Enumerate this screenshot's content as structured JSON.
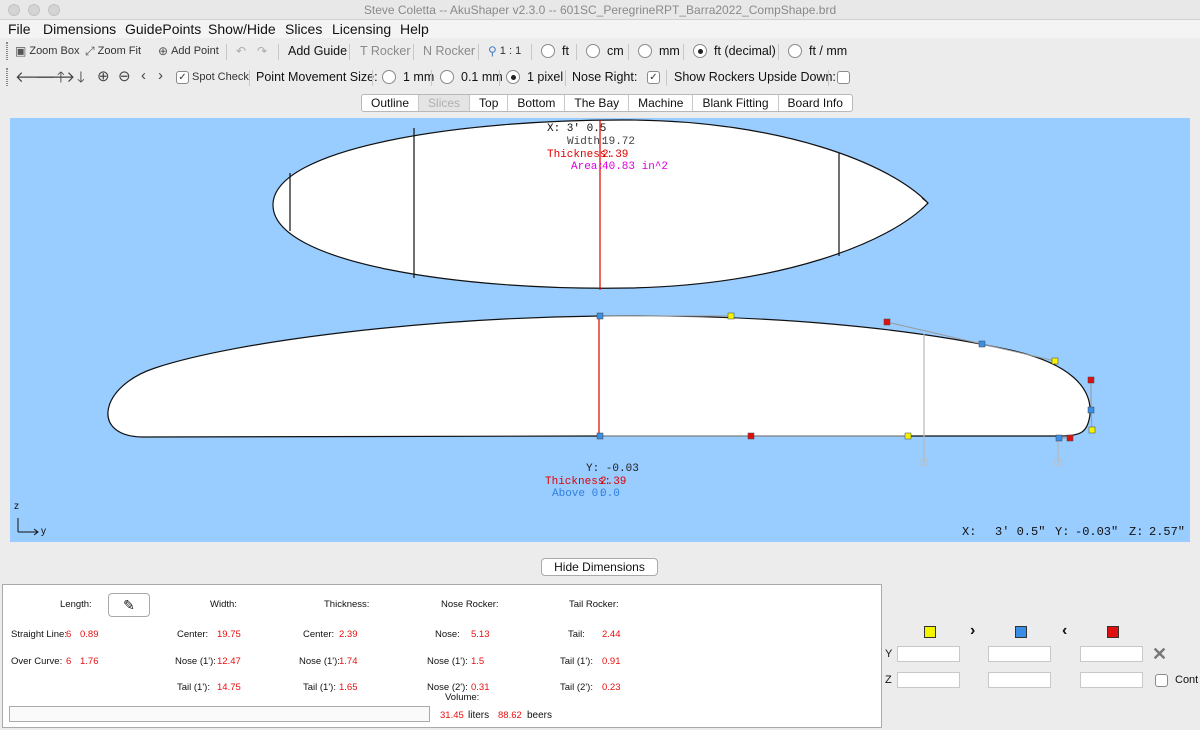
{
  "window": {
    "title": "Steve Coletta -- AkuShaper v2.3.0  --  601SC_PeregrineRPT_Barra2022_CompShape.brd"
  },
  "menu": [
    "File",
    "Dimensions",
    "GuidePoints",
    "Show/Hide",
    "Slices",
    "Licensing",
    "Help"
  ],
  "toolbar1": {
    "zoom_box": "Zoom Box",
    "zoom_fit": "Zoom Fit",
    "add_point": "Add Point",
    "add_guide": "Add Guide",
    "t_rocker": "T Rocker",
    "n_rocker": "N Rocker",
    "scale": "1 : 1",
    "units": [
      {
        "label": "ft",
        "selected": false
      },
      {
        "label": "cm",
        "selected": false
      },
      {
        "label": "mm",
        "selected": false
      },
      {
        "label": "ft (decimal)",
        "selected": true
      },
      {
        "label": "ft / mm",
        "selected": false
      }
    ]
  },
  "toolbar2": {
    "spot_check": "Spot Check",
    "point_movement_label": "Point Movement Size:",
    "movement_options": [
      {
        "label": "1 mm",
        "selected": false
      },
      {
        "label": "0.1 mm",
        "selected": false
      },
      {
        "label": "1 pixel",
        "selected": true
      }
    ],
    "nose_right_label": "Nose Right:",
    "nose_right_checked": true,
    "show_rockers_label": "Show Rockers Upside Down:",
    "show_rockers_checked": false
  },
  "tabs": [
    "Outline",
    "Slices",
    "Top",
    "Bottom",
    "The Bay",
    "Machine",
    "Blank Fitting",
    "Board Info"
  ],
  "active_tab": "Slices",
  "canvas": {
    "outline_info": {
      "x": "X: 3' 0.5",
      "width_label": "Width:",
      "width_value": "19.72",
      "thickness_label": "Thickness:",
      "thickness_value": "2.39",
      "area_label": "Area:",
      "area_value": "40.83 in^2"
    },
    "rocker_info": {
      "y": "Y: -0.03",
      "thickness_label": "Thickness:",
      "thickness_value": "2.39",
      "above_label": "Above 0:",
      "above_value": "0.0"
    },
    "axis_z": "z",
    "axis_y": "y",
    "coords": {
      "x_label": "X:",
      "x_value": "3' 0.5\"",
      "y_label": "Y:",
      "y_value": "-0.03\"",
      "z_label": "Z:",
      "z_value": "2.57\""
    },
    "colors": {
      "background": "#99ccff",
      "cursor_line": "#e00000",
      "control_blue": "#3a8ee6",
      "control_yellow": "#f4f400",
      "control_red": "#e01010",
      "thickness_text": "#e00000",
      "area_text": "#e000e0",
      "above_text": "#2f7fe0"
    }
  },
  "hide_dimensions": "Hide Dimensions",
  "dimensions": {
    "length_label": "Length:",
    "straight_line_label": "Straight Line:",
    "straight_line_ft": "6",
    "straight_line_in": "0.89",
    "over_curve_label": "Over Curve:",
    "over_curve_ft": "6",
    "over_curve_in": "1.76",
    "width_label": "Width:",
    "width_center_label": "Center:",
    "width_center": "19.75",
    "width_nose_label": "Nose (1'):",
    "width_nose": "12.47",
    "width_tail_label": "Tail (1'):",
    "width_tail": "14.75",
    "thickness_label": "Thickness:",
    "thick_center_label": "Center:",
    "thick_center": "2.39",
    "thick_nose_label": "Nose (1'):",
    "thick_nose": "1.74",
    "thick_tail_label": "Tail (1'):",
    "thick_tail": "1.65",
    "nose_rocker_label": "Nose Rocker:",
    "nr_nose_label": "Nose:",
    "nr_nose": "5.13",
    "nr_nose1_label": "Nose (1'):",
    "nr_nose1": "1.5",
    "nr_nose2_label": "Nose (2'):",
    "nr_nose2": "0.31",
    "tail_rocker_label": "Tail Rocker:",
    "tr_tail_label": "Tail:",
    "tr_tail": "2.44",
    "tr_tail1_label": "Tail (1'):",
    "tr_tail1": "0.91",
    "tr_tail2_label": "Tail (2'):",
    "tr_tail2": "0.23",
    "volume_label": "Volume:",
    "liters_value": "31.45",
    "liters_label": "liters",
    "beers_value": "88.62",
    "beers_label": "beers"
  },
  "side_panel": {
    "y_label": "Y",
    "z_label": "Z",
    "cont_label": "Cont"
  }
}
